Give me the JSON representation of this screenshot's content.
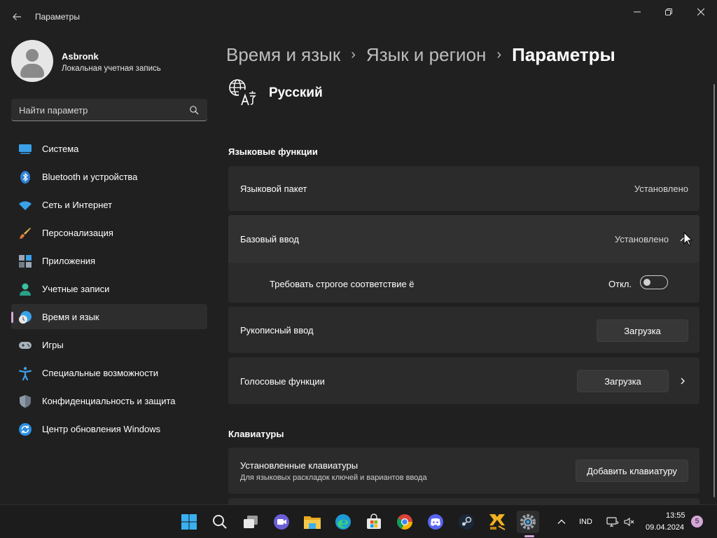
{
  "window": {
    "title": "Параметры"
  },
  "profile": {
    "name": "Asbronk",
    "account_type": "Локальная учетная запись"
  },
  "search": {
    "placeholder": "Найти параметр"
  },
  "sidebar": {
    "items": [
      {
        "label": "Система",
        "icon": "system-monitor-icon"
      },
      {
        "label": "Bluetooth и устройства",
        "icon": "bluetooth-icon"
      },
      {
        "label": "Сеть и Интернет",
        "icon": "wifi-icon"
      },
      {
        "label": "Персонализация",
        "icon": "brush-icon"
      },
      {
        "label": "Приложения",
        "icon": "apps-icon"
      },
      {
        "label": "Учетные записи",
        "icon": "account-icon"
      },
      {
        "label": "Время и язык",
        "icon": "time-language-icon",
        "active": true
      },
      {
        "label": "Игры",
        "icon": "gamepad-icon"
      },
      {
        "label": "Специальные возможности",
        "icon": "accessibility-icon"
      },
      {
        "label": "Конфиденциальность и защита",
        "icon": "shield-icon"
      },
      {
        "label": "Центр обновления Windows",
        "icon": "update-icon"
      }
    ]
  },
  "breadcrumb": {
    "items": [
      "Время и язык",
      "Язык и регион",
      "Параметры"
    ]
  },
  "language": {
    "name": "Русский",
    "icon": "language-icon"
  },
  "language_features": {
    "title": "Языковые функции",
    "language_pack": {
      "label": "Языковой пакет",
      "value": "Установлено"
    },
    "basic_typing": {
      "label": "Базовый ввод",
      "value": "Установлено",
      "expanded": true
    },
    "strict_yo": {
      "label": "Требовать строгое соответствие ё",
      "state_label": "Откл.",
      "on": false
    },
    "handwriting": {
      "label": "Рукописный ввод",
      "button": "Загрузка"
    },
    "speech": {
      "label": "Голосовые функции",
      "button": "Загрузка"
    }
  },
  "keyboards": {
    "title": "Клавиатуры",
    "installed": {
      "label": "Установленные клавиатуры",
      "description": "Для языковых раскладок ключей и вариантов ввода",
      "button": "Добавить клавиатуру"
    }
  },
  "taskbar": {
    "apps": [
      "start-icon",
      "search-icon",
      "task-view-icon",
      "meet-icon",
      "file-explorer-icon",
      "edge-icon",
      "store-icon",
      "chrome-icon",
      "discord-icon",
      "steam-icon",
      "network-tool-icon",
      "settings-icon"
    ],
    "input_language": "IND",
    "time": "13:55",
    "date": "09.04.2024",
    "notification_count": "5"
  },
  "colors": {
    "background": "#202020",
    "card": "#2b2b2b",
    "accent": "#d6a6d8"
  }
}
